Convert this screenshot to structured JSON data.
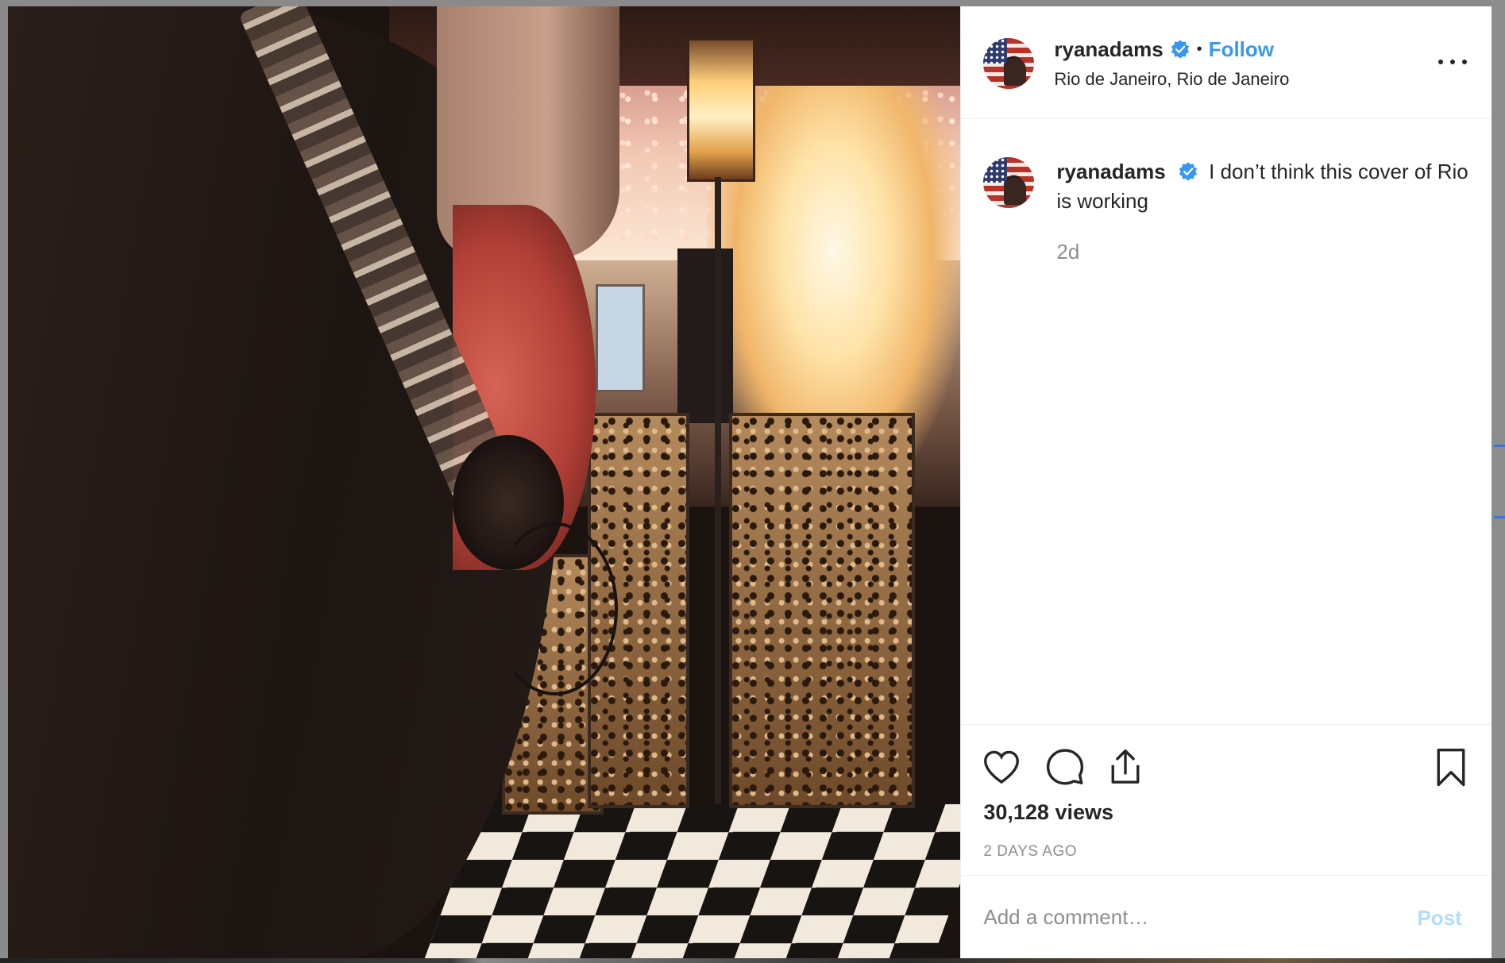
{
  "post": {
    "username": "ryanadams",
    "follow_label": "Follow",
    "separator": "•",
    "location": "Rio de Janeiro, Rio de Janeiro",
    "caption": "I don’t think this cover of Rio is working",
    "time_ago": "2d",
    "views": "30,128 views",
    "posted": "2 DAYS AGO"
  },
  "comment": {
    "placeholder": "Add a comment…",
    "post_label": "Post"
  },
  "colors": {
    "link_blue": "#3897f0",
    "verified_blue": "#3897f0",
    "muted_text": "#8e8e8e",
    "post_disabled": "#b3dbff"
  },
  "icons": {
    "verified": "verified-badge-icon",
    "more": "more-options-icon",
    "like": "heart-icon",
    "comment": "comment-bubble-icon",
    "share": "share-icon",
    "save": "bookmark-icon"
  }
}
